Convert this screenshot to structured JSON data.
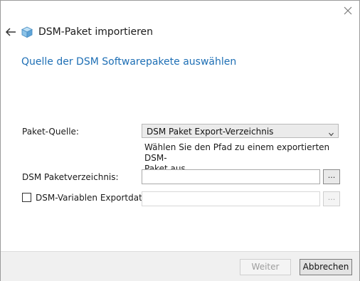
{
  "window": {
    "title": "DSM-Paket importieren",
    "heading": "Quelle der DSM Softwarepakete auswählen"
  },
  "icons": {
    "close": "close-icon",
    "back": "back-arrow-icon",
    "app": "package-icon",
    "dropdown": "chevron-down-icon"
  },
  "colors": {
    "heading": "#1e6fb5",
    "footer_bg": "#f0f0f0"
  },
  "form": {
    "source_label": "Paket-Quelle:",
    "source_value": "DSM Paket Export-Verzeichnis",
    "hint_line1": "Wählen Sie den Pfad zu einem exportierten DSM-",
    "hint_line2": "Paket aus.",
    "dir_label": "DSM Paketverzeichnis:",
    "dir_value": "",
    "browse_label": "...",
    "var_label": "DSM-Variablen Exportdatei:",
    "var_checked": false,
    "var_value": ""
  },
  "footer": {
    "next_label": "Weiter",
    "cancel_label": "Abbrechen"
  }
}
